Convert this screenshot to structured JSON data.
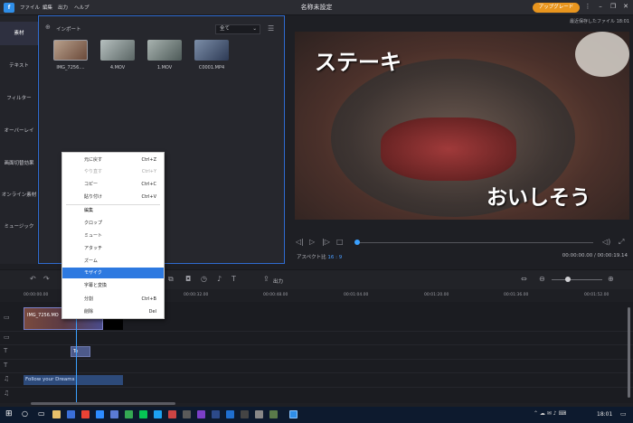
{
  "titlebar": {
    "logo_text": "f",
    "menu": [
      "ファイル",
      "編集",
      "出力",
      "ヘルプ"
    ],
    "title": "名称未設定",
    "upgrade_label": "アップグレード",
    "autosave_text": "最近保存したファイル 18:01"
  },
  "leftnav": {
    "items": [
      {
        "label": "素材",
        "active": true
      },
      {
        "label": "テキスト",
        "active": false
      },
      {
        "label": "フィルター",
        "active": false
      },
      {
        "label": "オーバーレイ",
        "active": false
      },
      {
        "label": "画面切替効果",
        "active": false
      },
      {
        "label": "オンライン素材",
        "active": false
      },
      {
        "label": "ミュージック",
        "active": false
      }
    ]
  },
  "media": {
    "import_label": "インポート",
    "filter_value": "全て",
    "items": [
      {
        "name": "IMG_7256....",
        "color": "#8a6f5d",
        "selected": true
      },
      {
        "name": "4.MOV",
        "color": "#7d8a8a",
        "selected": false
      },
      {
        "name": "1.MOV",
        "color": "#6c7a78",
        "selected": false
      },
      {
        "name": "C0001.MP4",
        "color": "#5b6e8a",
        "selected": false
      }
    ]
  },
  "preview": {
    "caption_top": "ステーキ",
    "caption_bottom": "おいしそう",
    "aspect_label": "アスペクト比",
    "aspect_value": "16 : 9",
    "timecode": "00:00:00.00 / 00:00:19.14",
    "colors": {
      "plate": "#3a3a3c",
      "meat": "#7d2a2a",
      "bg": "#5a4036"
    }
  },
  "timeline": {
    "export_label": "出力",
    "ticks": [
      "00:00:00.00",
      "00:00:16.00",
      "00:00:32.00",
      "00:00:48.00",
      "00:01:04.00",
      "00:01:20.00",
      "00:01:36.00",
      "00:01:52.00"
    ],
    "clip_video_label": "IMG_7256.MO",
    "clip_text_label": "Te",
    "clip_music_label": "Follow your Dreams"
  },
  "context_menu": {
    "items": [
      {
        "label": "元に戻す",
        "shortcut": "Ctrl+Z",
        "disabled": false
      },
      {
        "label": "やり直す",
        "shortcut": "Ctrl+Y",
        "disabled": true
      },
      {
        "label": "コピー",
        "shortcut": "Ctrl+C",
        "disabled": false
      },
      {
        "label": "貼り付け",
        "shortcut": "Ctrl+V",
        "disabled": false
      },
      {
        "label": "編集",
        "shortcut": "",
        "disabled": false
      },
      {
        "label": "クロップ",
        "shortcut": "",
        "disabled": false
      },
      {
        "label": "ミュート",
        "shortcut": "",
        "disabled": false
      },
      {
        "label": "アタッチ",
        "shortcut": "",
        "disabled": false
      },
      {
        "label": "ズーム",
        "shortcut": "",
        "disabled": false
      },
      {
        "label": "モザイク",
        "shortcut": "",
        "disabled": false,
        "highlight": true
      },
      {
        "label": "字幕と変換",
        "shortcut": "",
        "disabled": false
      },
      {
        "label": "分割",
        "shortcut": "Ctrl+B",
        "disabled": false
      },
      {
        "label": "削除",
        "shortcut": "Del",
        "disabled": false
      }
    ]
  },
  "taskbar": {
    "clock": "18:01"
  }
}
